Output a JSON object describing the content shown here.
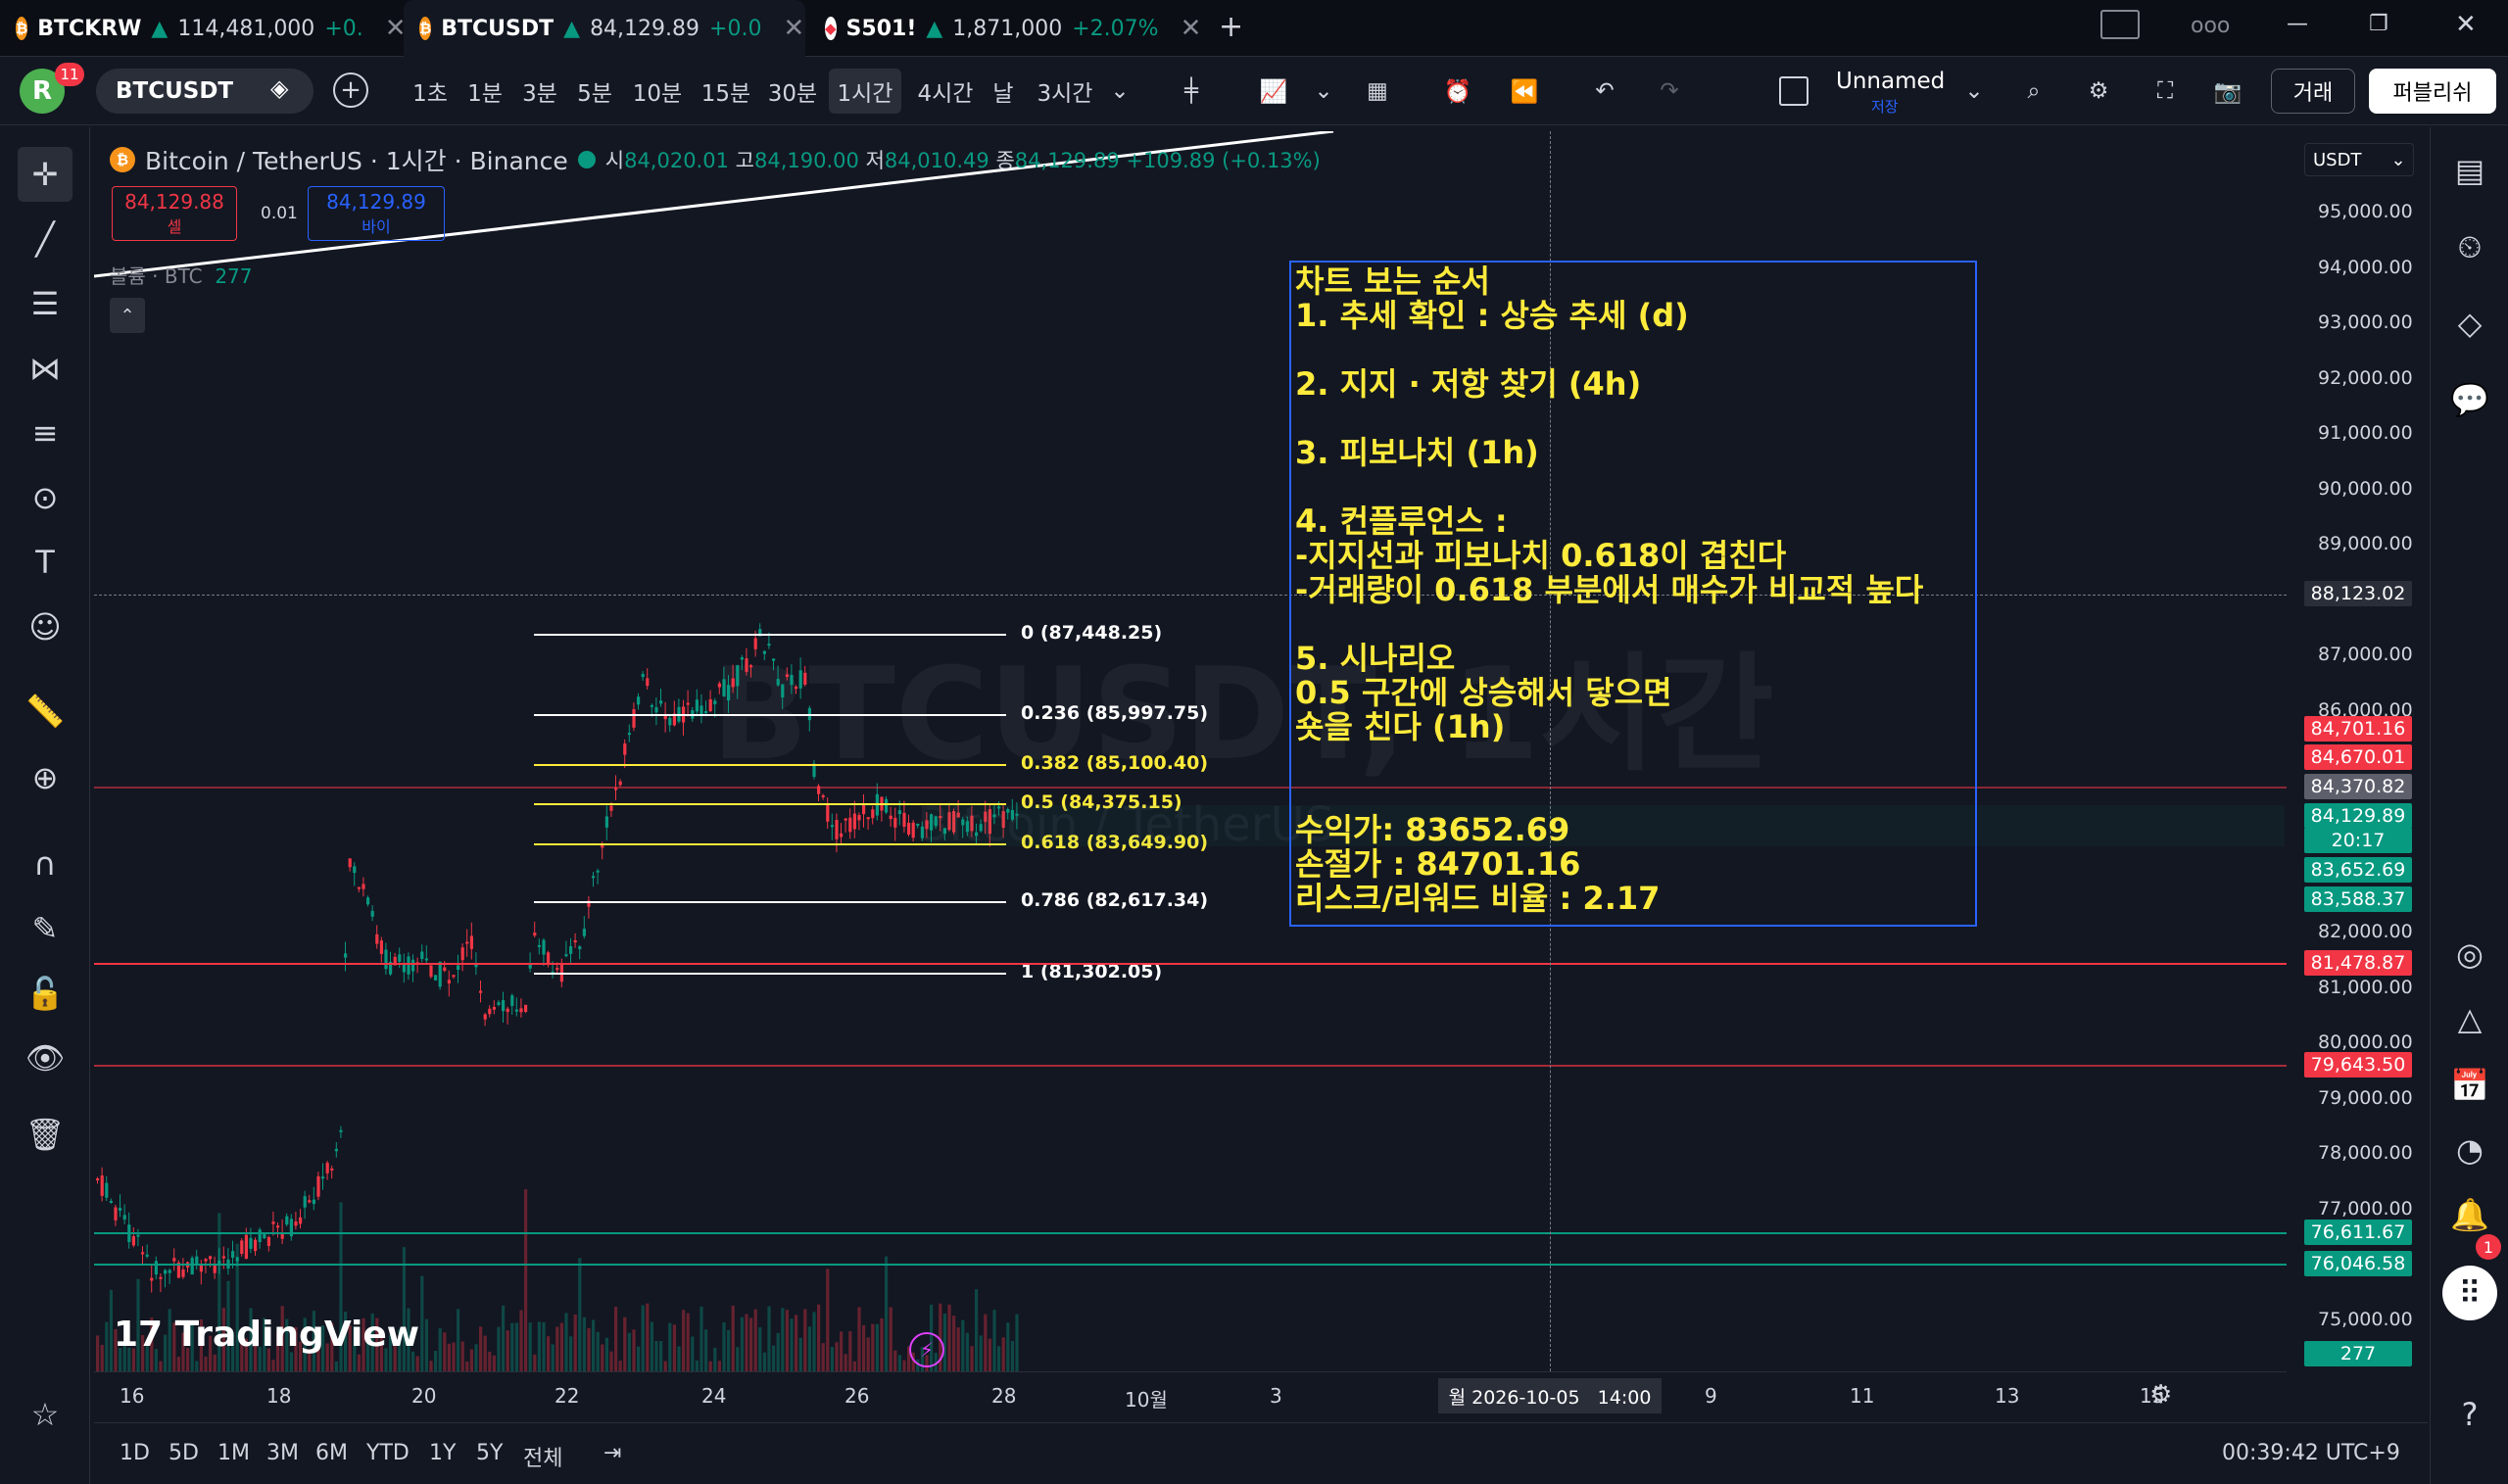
{
  "tabs": [
    {
      "name": "BTCKRW",
      "arrow": "▲",
      "price": "114,481,000",
      "change": "+0.",
      "close": "✕"
    },
    {
      "name": "BTCUSDT",
      "arrow": "▲",
      "price": "84,129.89",
      "change": "+0.0",
      "close": "✕"
    },
    {
      "name": "S501!",
      "arrow": "▲",
      "price": "1,871,000",
      "change": "+2.07%",
      "close": "✕"
    }
  ],
  "tabbar": {
    "new_tab": "+",
    "ooo": "ooo",
    "minimize": "—",
    "maximize": "❐",
    "close": "✕"
  },
  "toolbar": {
    "avatar": "R",
    "avatar_badge": "11",
    "symbol": "BTCUSDT",
    "intervals": [
      "1초",
      "1분",
      "3분",
      "5분",
      "10분",
      "15분",
      "30분",
      "1시간",
      "4시간",
      "날",
      "3시간"
    ],
    "selected_interval": "1시간",
    "layout_name": "Unnamed",
    "layout_saved": "저장",
    "trade_button": "거래",
    "publish_button": "퍼블리쉬"
  },
  "legend": {
    "title": "Bitcoin / TetherUS · 1시간 · Binance",
    "open_label": "시",
    "open": "84,020.01",
    "high_label": "고",
    "high": "84,190.00",
    "low_label": "저",
    "low": "84,010.49",
    "close_label": "종",
    "close": "84,129.89",
    "change": "+109.89 (+0.13%)",
    "sell_price": "84,129.88",
    "sell_label": "셀",
    "spread": "0.01",
    "buy_price": "84,129.89",
    "buy_label": "바이",
    "volume_label": "볼륨 · BTC",
    "volume": "277",
    "collapse": "⌃"
  },
  "watermark": {
    "symbol": "BTCUSDT, 1시간",
    "name": "Bitcoin / TetherUS"
  },
  "currency": "USDT",
  "info_box": {
    "text": "차트 보는 순서\n1. 추세 확인 : 상승 추세 (d)\n\n2. 지지 · 저항 찾기 (4h)\n\n3. 피보나치 (1h)\n\n4. 컨플루언스 :\n-지지선과 피보나치 0.618이 겹친다\n-거래량이 0.618 부분에서 매수가 비교적 높다\n\n5. 시나리오\n0.5 구간에 상승해서 닿으면\n숏을 친다 (1h)\n\n\n수익가: 83652.69\n손절가 : 84701.16\n리스크/리워드 비율 : 2.17"
  },
  "fib_levels": [
    {
      "label": "0 (87,448.25)",
      "price": 87448.25,
      "color": "#ffffff"
    },
    {
      "label": "0.236 (85,997.75)",
      "price": 85997.75,
      "color": "#ffffff"
    },
    {
      "label": "0.382 (85,100.40)",
      "price": 85100.4,
      "color": "#ffeb3b"
    },
    {
      "label": "0.5 (84,375.15)",
      "price": 84375.15,
      "color": "#ffeb3b"
    },
    {
      "label": "0.618 (83,649.90)",
      "price": 83649.9,
      "color": "#ffeb3b"
    },
    {
      "label": "0.786 (82,617.34)",
      "price": 82617.34,
      "color": "#ffffff"
    },
    {
      "label": "1 (81,302.05)",
      "price": 81302.05,
      "color": "#ffffff"
    }
  ],
  "price_axis": {
    "ticks": [
      "95,000.00",
      "94,000.00",
      "93,000.00",
      "92,000.00",
      "91,000.00",
      "90,000.00",
      "89,000.00",
      "87,000.00",
      "86,000.00",
      "82,000.00",
      "81,000.00",
      "80,000.00",
      "79,000.00",
      "78,000.00",
      "77,000.00",
      "75,000.00"
    ],
    "crosshair": "88,123.02",
    "tags": [
      {
        "text": "84,701.16",
        "color": "#f23645"
      },
      {
        "text": "84,670.01",
        "color": "#f23645"
      },
      {
        "text": "84,370.82",
        "color": "#5d606b"
      },
      {
        "text": "84,129.89",
        "color": "#089981"
      },
      {
        "text": "20:17",
        "color": "#089981"
      },
      {
        "text": "83,652.69",
        "color": "#089981"
      },
      {
        "text": "83,588.37",
        "color": "#089981"
      },
      {
        "text": "81,478.87",
        "color": "#f23645"
      },
      {
        "text": "79,643.50",
        "color": "#f23645"
      },
      {
        "text": "76,611.67",
        "color": "#089981"
      },
      {
        "text": "76,046.58",
        "color": "#089981"
      },
      {
        "text": "277",
        "color": "#089981"
      }
    ]
  },
  "time_axis": {
    "labels": [
      "16",
      "18",
      "20",
      "22",
      "24",
      "26",
      "28",
      "10월",
      "3",
      "9",
      "11",
      "13",
      "15"
    ],
    "crosshair": "월 2026-10-05   14:00"
  },
  "bottom": {
    "ranges": [
      "1D",
      "5D",
      "1M",
      "3M",
      "6M",
      "YTD",
      "1Y",
      "5Y",
      "전체"
    ],
    "clock": "00:39:42 UTC+9"
  },
  "logo": "TradingView",
  "colors": {
    "up": "#089981",
    "down": "#f23645",
    "fib_yellow": "#ffeb3b",
    "info_border": "#2962ff",
    "bg": "#131722"
  }
}
